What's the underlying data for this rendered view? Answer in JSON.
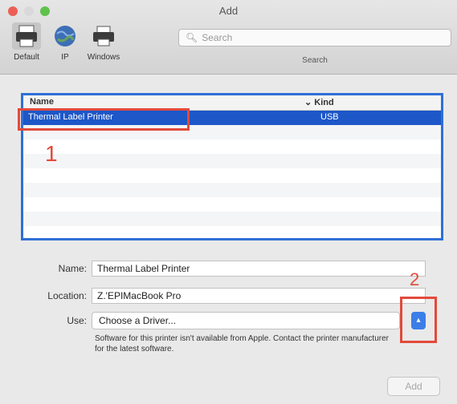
{
  "window": {
    "title": "Add"
  },
  "toolbar": {
    "items": [
      {
        "label": "Default",
        "icon": "printer-icon",
        "selected": true
      },
      {
        "label": "IP",
        "icon": "globe-icon",
        "selected": false
      },
      {
        "label": "Windows",
        "icon": "windows-printer-icon",
        "selected": false
      }
    ],
    "search": {
      "placeholder": "Search",
      "caption": "Search"
    }
  },
  "printer_list": {
    "columns": [
      "Name",
      "Kind"
    ],
    "rows": [
      {
        "name": "Thermal Label Printer",
        "kind": "USB",
        "selected": true
      }
    ]
  },
  "annotations": {
    "step1": "1",
    "step2": "2",
    "color": "#e24a3b"
  },
  "form": {
    "name_label": "Name:",
    "name_value": "Thermal Label Printer",
    "location_label": "Location:",
    "location_value": "Z.'EPIMacBook Pro",
    "use_label": "Use:",
    "use_value": "Choose a Driver...",
    "notice": "Software for this printer isn't available from Apple. Contact the printer manufacturer for the latest software."
  },
  "buttons": {
    "add": "Add"
  },
  "colors": {
    "accent": "#1d57c8",
    "selection_border": "#2f6fd6"
  }
}
